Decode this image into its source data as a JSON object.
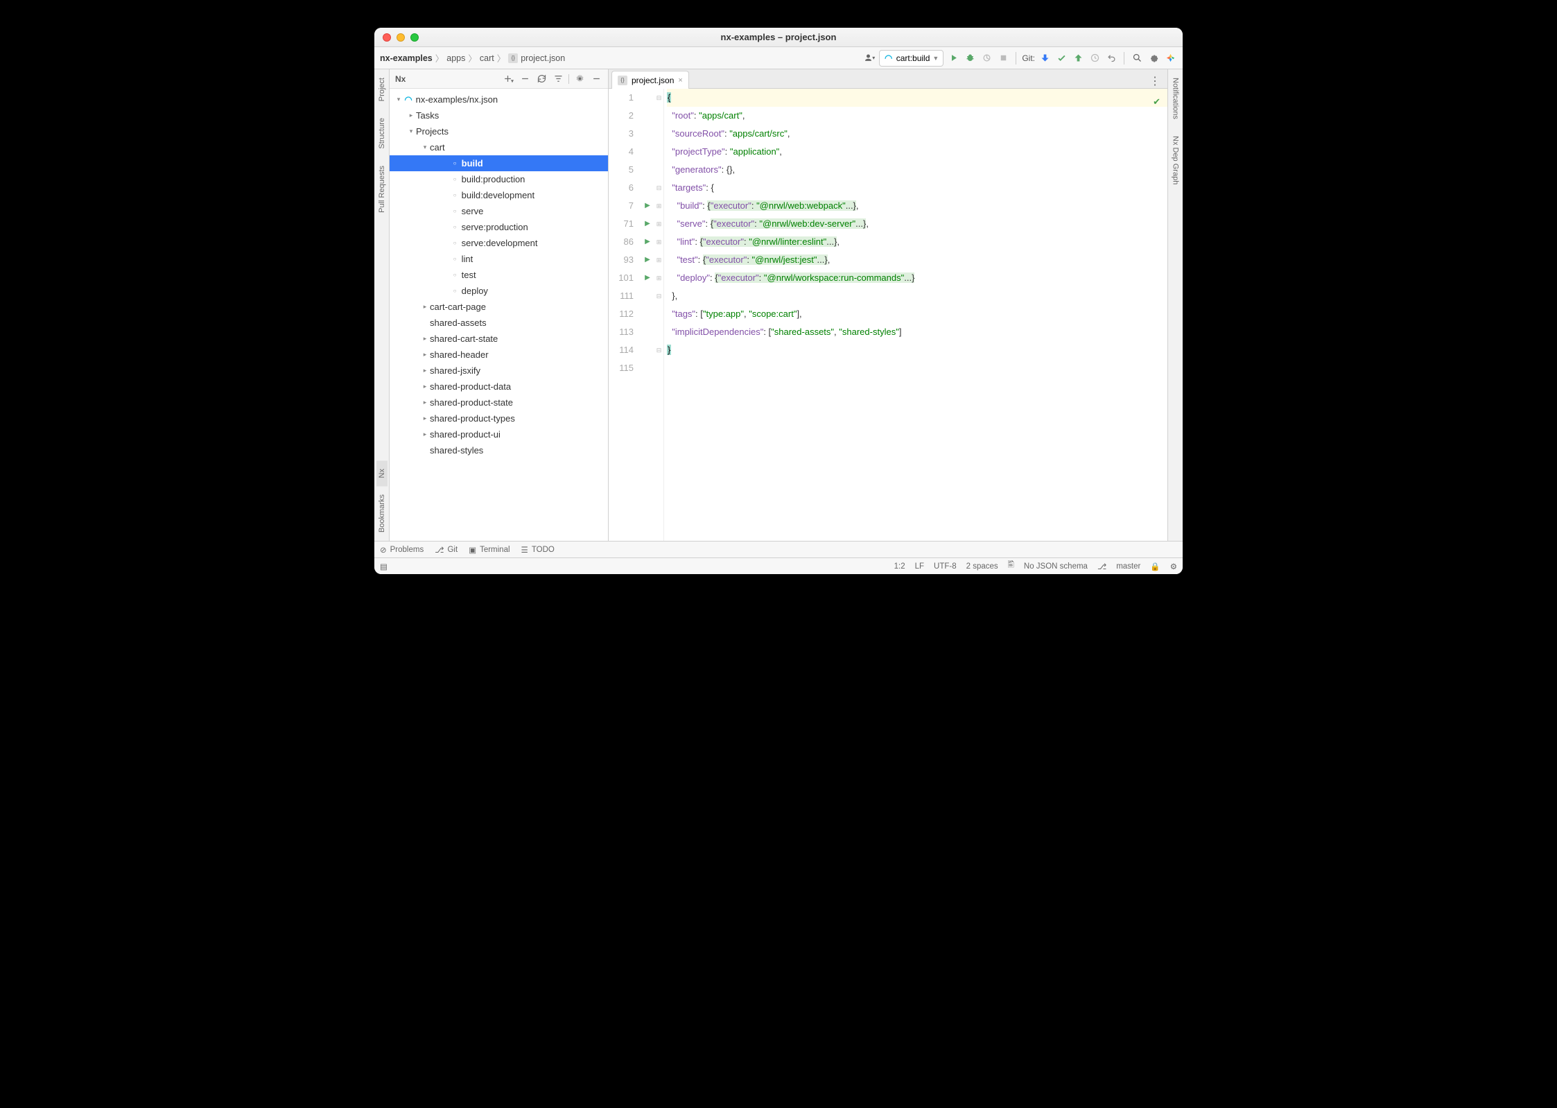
{
  "window": {
    "title": "nx-examples – project.json"
  },
  "breadcrumbs": [
    "nx-examples",
    "apps",
    "cart",
    "project.json"
  ],
  "run_config": {
    "label": "cart:build"
  },
  "git_label": "Git:",
  "sidebar": {
    "title": "Nx",
    "root": "nx-examples/nx.json",
    "tasks_label": "Tasks",
    "projects_label": "Projects",
    "cart_label": "cart",
    "cart_targets": [
      "build",
      "build:production",
      "build:development",
      "serve",
      "serve:production",
      "serve:development",
      "lint",
      "test",
      "deploy"
    ],
    "projects": [
      "cart-cart-page",
      "shared-assets",
      "shared-cart-state",
      "shared-header",
      "shared-jsxify",
      "shared-product-data",
      "shared-product-state",
      "shared-product-types",
      "shared-product-ui",
      "shared-styles"
    ]
  },
  "left_rail": {
    "tabs": [
      "Project",
      "Structure",
      "Pull Requests",
      "Nx",
      "Bookmarks"
    ]
  },
  "right_rail": {
    "tabs": [
      "Notifications",
      "Nx Dep Graph"
    ]
  },
  "tab": {
    "name": "project.json"
  },
  "editor": {
    "line_numbers": [
      "1",
      "2",
      "3",
      "4",
      "5",
      "6",
      "7",
      "71",
      "86",
      "93",
      "101",
      "111",
      "112",
      "113",
      "114",
      "115"
    ],
    "run_rows": [
      6,
      7,
      8,
      9,
      10
    ],
    "content": {
      "root": "apps/cart",
      "sourceRoot": "apps/cart/src",
      "projectType": "application",
      "targets": {
        "build": "@nrwl/web:webpack",
        "serve": "@nrwl/web:dev-server",
        "lint": "@nrwl/linter:eslint",
        "test": "@nrwl/jest:jest",
        "deploy": "@nrwl/workspace:run-commands"
      },
      "tags": [
        "type:app",
        "scope:cart"
      ],
      "implicitDependencies": [
        "shared-assets",
        "shared-styles"
      ]
    }
  },
  "bottom": {
    "tabs": [
      "Problems",
      "Git",
      "Terminal",
      "TODO"
    ]
  },
  "status": {
    "pos": "1:2",
    "line_sep": "LF",
    "encoding": "UTF-8",
    "indent": "2 spaces",
    "schema": "No JSON schema",
    "branch": "master"
  }
}
